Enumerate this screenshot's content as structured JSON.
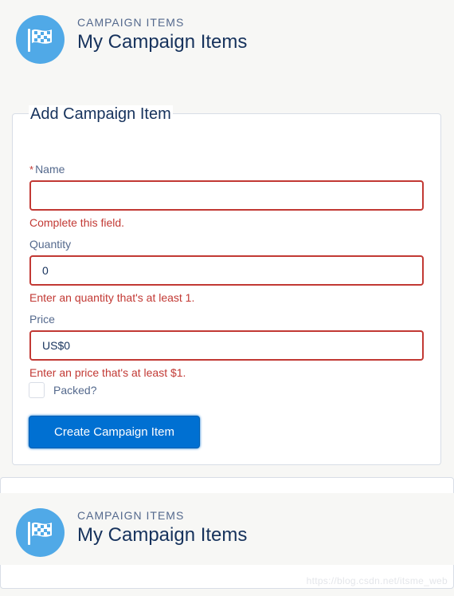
{
  "header": {
    "eyebrow": "CAMPAIGN ITEMS",
    "title": "My Campaign Items",
    "icon": "campaign-flag-icon",
    "icon_bg": "#50a9e7"
  },
  "form": {
    "title": "Add Campaign Item",
    "name": {
      "required_mark": "*",
      "label": "Name",
      "value": "",
      "error": "Complete this field."
    },
    "quantity": {
      "label": "Quantity",
      "value": "0",
      "error": "Enter an quantity that's at least 1."
    },
    "price": {
      "label": "Price",
      "value": "US$0",
      "error": "Enter an price that's at least $1."
    },
    "packed": {
      "label": "Packed?",
      "checked": false
    },
    "submit_label": "Create Campaign Item"
  },
  "list_header": {
    "eyebrow": "CAMPAIGN ITEMS",
    "title": "My Campaign Items",
    "icon": "campaign-flag-icon"
  },
  "watermark": "https://blog.csdn.net/itsme_web",
  "colors": {
    "error": "#c23934",
    "brand": "#0070d2",
    "text": "#16325c",
    "muted": "#54698d"
  }
}
